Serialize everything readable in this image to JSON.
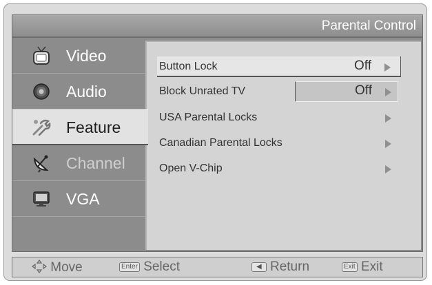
{
  "header": {
    "title": "Parental Control"
  },
  "sidebar": {
    "items": [
      {
        "label": "Video",
        "icon": "tv-icon"
      },
      {
        "label": "Audio",
        "icon": "speaker-icon"
      },
      {
        "label": "Feature",
        "icon": "tools-icon",
        "active": true
      },
      {
        "label": "Channel",
        "icon": "satellite-dish-icon"
      },
      {
        "label": "VGA",
        "icon": "monitor-icon"
      }
    ]
  },
  "menu": {
    "rows": [
      {
        "label": "Button Lock",
        "value": "Off"
      },
      {
        "label": "Block Unrated TV",
        "value": "Off"
      },
      {
        "label": "USA Parental Locks",
        "value": ""
      },
      {
        "label": "Canadian Parental Locks",
        "value": ""
      },
      {
        "label": "Open V-Chip",
        "value": ""
      }
    ]
  },
  "footer": {
    "move": "Move",
    "enter_key": "Enter",
    "select": "Select",
    "return": "Return",
    "exit_key": "Exit",
    "exit": "Exit"
  },
  "colors": {
    "panel": "#8c8c8c",
    "content": "#d4d4d4",
    "highlight": "#e6e6e6"
  }
}
